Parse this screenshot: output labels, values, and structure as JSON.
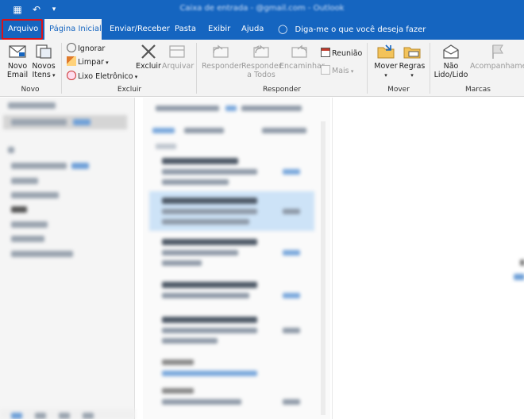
{
  "titlebar": {
    "title": "Caixa de entrada - @gmail.com - Outlook"
  },
  "tabs": [
    {
      "id": "arquivo",
      "label": "Arquivo"
    },
    {
      "id": "pagina-inicial",
      "label": "Página Inicial"
    },
    {
      "id": "enviar-receber",
      "label": "Enviar/Receber"
    },
    {
      "id": "pasta",
      "label": "Pasta"
    },
    {
      "id": "exibir",
      "label": "Exibir"
    },
    {
      "id": "ajuda",
      "label": "Ajuda"
    }
  ],
  "tellme": {
    "label": "Diga-me o que você deseja fazer"
  },
  "ribbon": {
    "novo": {
      "label": "Novo",
      "novo_email_1": "Novo",
      "novo_email_2": "Email",
      "novos_itens_1": "Novos",
      "novos_itens_2": "Itens"
    },
    "excluir": {
      "label": "Excluir",
      "ignorar": "Ignorar",
      "limpar": "Limpar",
      "lixo": "Lixo Eletrônico",
      "excluir": "Excluir",
      "arquivar": "Arquivar"
    },
    "responder": {
      "label": "Responder",
      "responder": "Responder",
      "responder_todos_1": "Responder",
      "responder_todos_2": "a Todos",
      "encaminhar": "Encaminhar",
      "reuniao": "Reunião",
      "mais": "Mais"
    },
    "mover": {
      "label": "Mover",
      "mover": "Mover",
      "regras": "Regras"
    },
    "marcas": {
      "label": "Marcas",
      "nao_lido_1": "Não",
      "nao_lido_2": "Lido/Lido",
      "acompanhamento": "Acompanhamento"
    }
  },
  "colors": {
    "accent": "#1565c0",
    "highlight": "#d8121a",
    "ribbon_bg": "#f3f3f3"
  }
}
